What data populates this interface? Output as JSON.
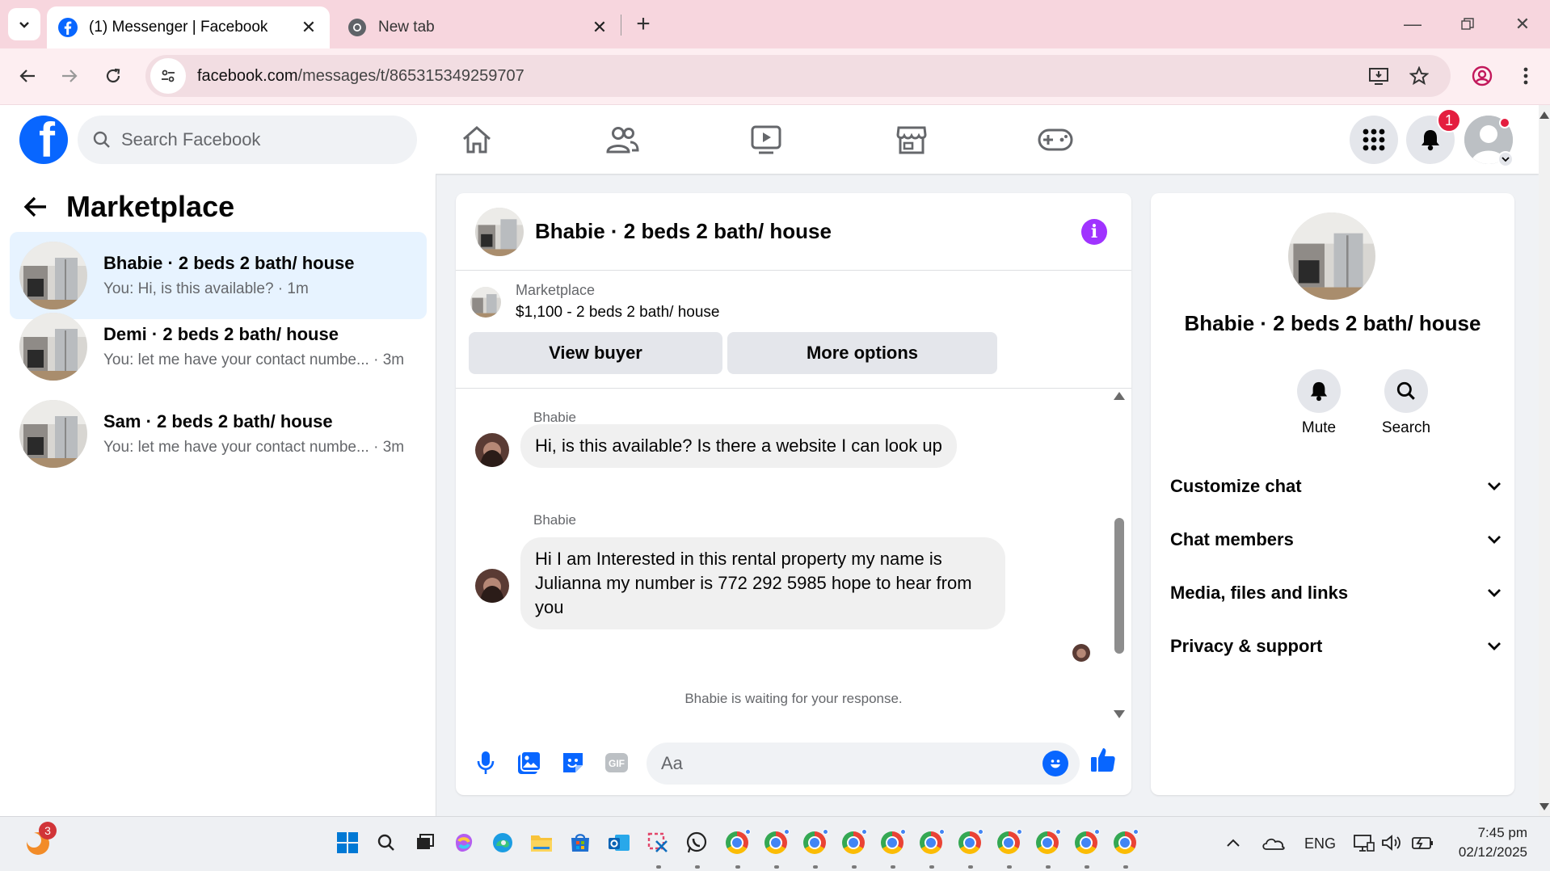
{
  "browser": {
    "tabs": [
      {
        "title": "(1) Messenger | Facebook",
        "active": true
      },
      {
        "title": "New tab",
        "active": false
      }
    ],
    "url_host": "facebook.com",
    "url_path": "/messages/t/865315349259707"
  },
  "fb_header": {
    "logo": "f",
    "search_placeholder": "Search Facebook",
    "notification_count": "1",
    "nav_icons": [
      "home-icon",
      "friends-icon",
      "watch-icon",
      "marketplace-icon",
      "gaming-icon"
    ]
  },
  "left_panel": {
    "title": "Marketplace",
    "conversations": [
      {
        "name": "Bhabie · 2 beds 2 bath/ house",
        "preview": "You: Hi, is this available? · 1m",
        "active": true
      },
      {
        "name": "Demi · 2 beds 2 bath/ house",
        "preview": "You: let me have your contact numbe... · 3m",
        "active": false
      },
      {
        "name": "Sam · 2 beds 2 bath/ house",
        "preview": "You: let me have your contact numbe... · 3m",
        "active": false
      }
    ]
  },
  "chat": {
    "title": "Bhabie · 2 beds 2 bath/ house",
    "marketplace_label": "Marketplace",
    "listing": "$1,100 - 2 beds 2 bath/ house",
    "view_buyer": "View buyer",
    "more_options": "More options",
    "messages": [
      {
        "sender": "Bhabie",
        "text": "Hi, is this available? Is there a website I can look up"
      },
      {
        "sender": "Bhabie",
        "text": "Hi I am Interested in this rental property my name is Julianna my number is 772 292 5985 hope to hear from you"
      }
    ],
    "waiting_note": "Bhabie is waiting for your response.",
    "composer_placeholder": "Aa"
  },
  "right_panel": {
    "name": "Bhabie · 2 beds 2 bath/ house",
    "mute": "Mute",
    "search": "Search",
    "sections": [
      "Customize chat",
      "Chat members",
      "Media, files and links",
      "Privacy & support"
    ]
  },
  "taskbar": {
    "notification_badge": "3",
    "language": "ENG",
    "time": "7:45 pm",
    "date": "02/12/2025"
  },
  "colors": {
    "fb_blue": "#0866ff",
    "tab_strip": "#f7d6de",
    "active_conv": "#e7f3ff",
    "info_purple": "#a033ff",
    "badge_red": "#e41e3f"
  }
}
